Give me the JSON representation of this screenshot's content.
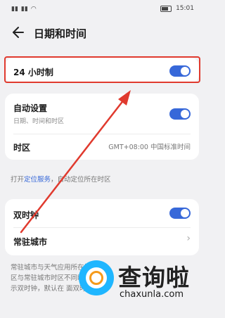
{
  "status_bar": {
    "left_icons": [
      "signal-icon",
      "signal-icon",
      "wifi-icon"
    ],
    "time": "15:01"
  },
  "header": {
    "title": "日期和时间"
  },
  "settings": {
    "hour24": {
      "label": "24 小时制",
      "enabled": true
    },
    "auto": {
      "label": "自动设置",
      "subtitle": "日期、时间和时区",
      "enabled": true
    },
    "timezone": {
      "label": "时区",
      "value": "GMT+08:00 中国标准时间"
    },
    "hint": {
      "prefix": "打开",
      "link": "定位服务",
      "suffix": "，自动定位所在时区"
    },
    "dual_clock": {
      "label": "双时钟",
      "enabled": true
    },
    "home_city": {
      "label": "常驻城市"
    },
    "bottom_text": "常驻城市与天气应用所在城市 区与常驻城市时区不同时 面显示双时钟，默认在 面双时钟。"
  },
  "watermark": {
    "title": "查询啦",
    "url": "chaxunla.com"
  },
  "colors": {
    "accent": "#3768d9",
    "annotation": "#e03a2e"
  }
}
